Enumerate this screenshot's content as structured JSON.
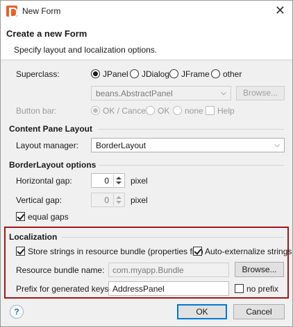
{
  "window": {
    "title": "New Form",
    "close_symbol": "✕"
  },
  "header": {
    "title": "Create a new Form",
    "subtitle": "Specify layout and localization options."
  },
  "superclass": {
    "label": "Superclass:",
    "options": [
      "JPanel",
      "JDialog",
      "JFrame",
      "other"
    ],
    "selected": "JPanel",
    "class_value": "beans.AbstractPanel",
    "browse_label": "Browse..."
  },
  "button_bar": {
    "label": "Button bar:",
    "options": [
      "OK / Cancel",
      "OK",
      "none"
    ],
    "selected": "OK / Cancel",
    "help_label": "Help",
    "help_checked": false
  },
  "content_pane": {
    "title": "Content Pane Layout",
    "layout_label": "Layout manager:",
    "layout_value": "BorderLayout"
  },
  "border_layout": {
    "title": "BorderLayout options",
    "hgap_label": "Horizontal gap:",
    "hgap_value": "0",
    "hgap_unit": "pixel",
    "vgap_label": "Vertical gap:",
    "vgap_value": "0",
    "vgap_unit": "pixel",
    "equal_gaps_label": "equal gaps",
    "equal_gaps_checked": true
  },
  "localization": {
    "title": "Localization",
    "store_label": "Store strings in resource bundle (properties file)",
    "store_checked": true,
    "auto_label": "Auto-externalize strings",
    "auto_checked": true,
    "bundle_label": "Resource bundle name:",
    "bundle_value": "com.myapp.Bundle",
    "browse_label": "Browse...",
    "prefix_label": "Prefix for generated keys:",
    "prefix_value": "AddressPanel",
    "no_prefix_label": "no prefix",
    "no_prefix_checked": false
  },
  "footer": {
    "help_symbol": "?",
    "ok_label": "OK",
    "cancel_label": "Cancel"
  },
  "colors": {
    "highlight_border": "#a01818",
    "default_button": "#0078d7",
    "app_icon": "#e8602c"
  }
}
